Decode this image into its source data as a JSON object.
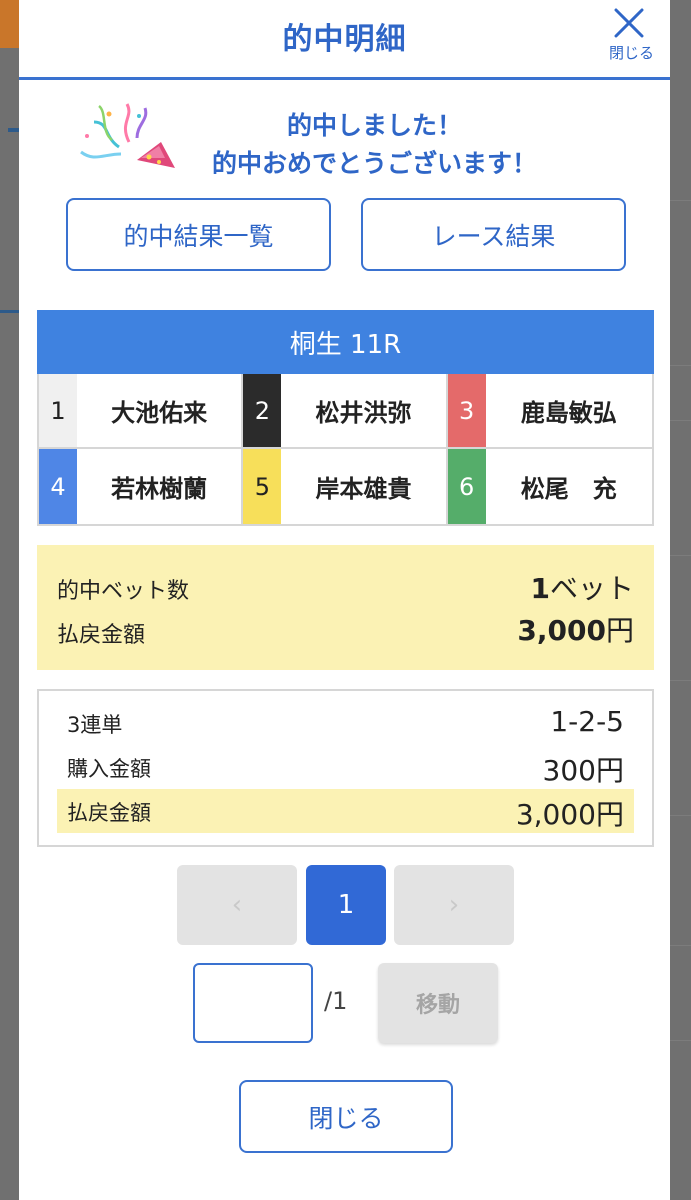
{
  "header": {
    "title": "的中明細",
    "close_label": "閉じる"
  },
  "congrats": {
    "line1": "的中しました！",
    "line2": "的中おめでとうございます！"
  },
  "actions": {
    "results_list": "的中結果一覧",
    "race_result": "レース結果"
  },
  "race": {
    "title": "桐生 11R",
    "racers": [
      {
        "num": "1",
        "name": "大池佑来",
        "bg": "#f0f0f0",
        "fg": "#222222"
      },
      {
        "num": "2",
        "name": "松井洪弥",
        "bg": "#2b2b2b",
        "fg": "#ffffff"
      },
      {
        "num": "3",
        "name": "鹿島敏弘",
        "bg": "#e46a6a",
        "fg": "#ffffff"
      },
      {
        "num": "4",
        "name": "若林樹蘭",
        "bg": "#4f86e6",
        "fg": "#ffffff"
      },
      {
        "num": "5",
        "name": "岸本雄貴",
        "bg": "#f7df5a",
        "fg": "#222222"
      },
      {
        "num": "6",
        "name": "松尾　充",
        "bg": "#55ad6a",
        "fg": "#ffffff"
      }
    ]
  },
  "summary": {
    "hit_bets_label": "的中ベット数",
    "hit_bets_number": "1",
    "hit_bets_unit": "ベット",
    "payout_label": "払戻金額",
    "payout_number": "3,000",
    "payout_unit": "円"
  },
  "detail": {
    "bet_type": "3連単",
    "combination": "1-2-5",
    "purchase_label": "購入金額",
    "purchase_value": "300円",
    "payout_label": "払戻金額",
    "payout_value": "3,000円"
  },
  "pager": {
    "prev": "‹",
    "current": "1",
    "next": "›"
  },
  "jump": {
    "input_value": "",
    "total": "/1",
    "button": "移動"
  },
  "footer": {
    "close_label": "閉じる"
  }
}
